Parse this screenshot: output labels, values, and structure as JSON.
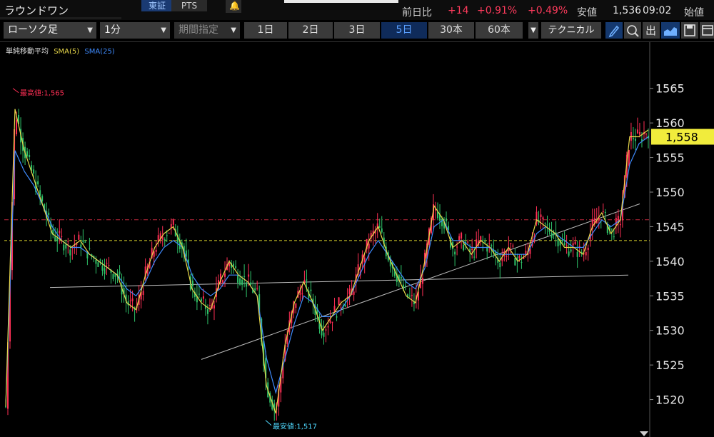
{
  "header": {
    "title": "ラウンドワン",
    "exchange_active": "東証",
    "exchange_pts": "PTS",
    "change_label": "前日比",
    "change_value": "+14",
    "change_pct": "+0.91%",
    "change_pct2": "+0.49%",
    "low_label": "安値",
    "low_value": "1,536",
    "time": "09:02",
    "open_label": "始値"
  },
  "toolbar": {
    "chart_type": "ローソク足",
    "interval": "1分",
    "range_placeholder": "期間指定",
    "periods": [
      "1日",
      "2日",
      "3日",
      "5日",
      "30本",
      "60本"
    ],
    "selected_period": "5日",
    "technical_label": "テクニカル",
    "icons": [
      "pencil-icon",
      "zoom-icon",
      "output-icon",
      "area-chart-icon",
      "save-icon",
      "window-icon"
    ]
  },
  "legend": {
    "title": "単純移動平均",
    "sma5": "SMA(5)",
    "sma25": "SMA(25)"
  },
  "annotations": {
    "high": "最高値:1,565",
    "low": "最安値:1,517"
  },
  "price_tag": "1,558",
  "colors": {
    "up": "#ff2f55",
    "down": "#2fc36a",
    "sma5": "#e8d84a",
    "sma25": "#3f8cff",
    "ref_red": "#c0283c",
    "ref_yellow": "#d8cf2a",
    "price_tag": "#f1ec3c"
  },
  "chart_data": {
    "type": "line",
    "title": "",
    "xlabel": "",
    "ylabel": "",
    "ylim": [
      1515,
      1569
    ],
    "yticks": [
      1520,
      1525,
      1530,
      1535,
      1540,
      1545,
      1550,
      1555,
      1560,
      1565
    ],
    "reference_lines": [
      {
        "value": 1546,
        "color": "red",
        "style": "dash-dot"
      },
      {
        "value": 1543,
        "color": "yellow",
        "style": "dashed"
      }
    ],
    "last_price": 1558,
    "high": 1565,
    "low": 1517,
    "series": [
      {
        "name": "SMA(5)",
        "values": [
          1519,
          1562,
          1556,
          1552,
          1548,
          1544,
          1543,
          1542,
          1543,
          1541,
          1540,
          1539,
          1538,
          1534,
          1533,
          1538,
          1542,
          1544,
          1545,
          1542,
          1536,
          1534,
          1533,
          1537,
          1540,
          1538,
          1537,
          1535,
          1522,
          1518,
          1528,
          1534,
          1537,
          1534,
          1530,
          1532,
          1534,
          1535,
          1539,
          1543,
          1545,
          1541,
          1538,
          1535,
          1534,
          1540,
          1548,
          1546,
          1542,
          1543,
          1541,
          1543,
          1542,
          1540,
          1542,
          1540,
          1541,
          1546,
          1545,
          1544,
          1542,
          1542,
          1541,
          1545,
          1547,
          1544,
          1546,
          1558,
          1558,
          1559
        ]
      },
      {
        "name": "SMA(25)",
        "values": [
          1519,
          1556,
          1553,
          1551,
          1548,
          1545,
          1543,
          1542,
          1542,
          1541,
          1540,
          1539,
          1538,
          1536,
          1535,
          1537,
          1540,
          1542,
          1543,
          1542,
          1538,
          1536,
          1535,
          1536,
          1538,
          1538,
          1537,
          1535,
          1526,
          1521,
          1526,
          1531,
          1535,
          1534,
          1532,
          1532,
          1533,
          1535,
          1538,
          1541,
          1543,
          1541,
          1539,
          1537,
          1536,
          1539,
          1545,
          1546,
          1543,
          1543,
          1542,
          1542,
          1542,
          1541,
          1541,
          1541,
          1541,
          1544,
          1545,
          1544,
          1543,
          1542,
          1542,
          1544,
          1546,
          1545,
          1546,
          1554,
          1557,
          1558
        ]
      }
    ]
  }
}
